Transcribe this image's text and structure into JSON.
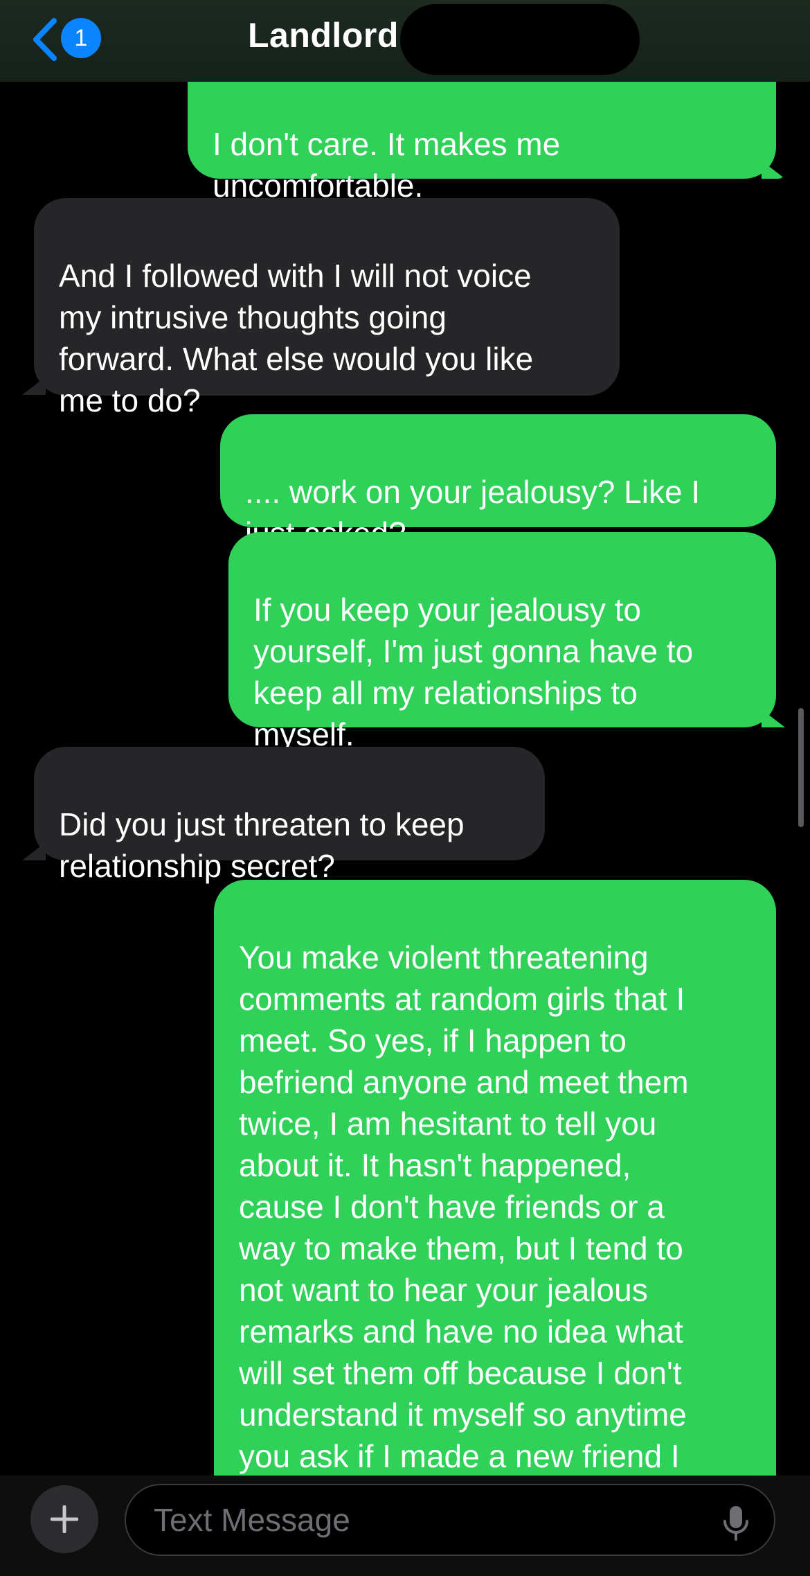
{
  "header": {
    "title": "Landlord",
    "back_badge": "1"
  },
  "messages": [
    {
      "from": "me",
      "text": "I don't care. It makes me\nuncomfortable."
    },
    {
      "from": "them",
      "text": "And I followed with I will not voice\nmy intrusive thoughts going\nforward. What else would you like\nme to do?"
    },
    {
      "from": "me",
      "text": ".... work on your jealousy? Like I\njust asked?"
    },
    {
      "from": "me",
      "text": "If you keep your jealousy to\nyourself, I'm just gonna have to\nkeep all my relationships to\nmyself."
    },
    {
      "from": "them",
      "text": "Did you just threaten to keep\nrelationship secret?"
    },
    {
      "from": "me",
      "text": "You make violent threatening\ncomments at random girls that I\nmeet. So yes, if I happen to\nbefriend anyone and meet them\ntwice, I am hesitant to tell you\nabout it. It hasn't happened,\ncause I don't have friends or a\nway to make them, but I tend to\nnot want to hear your jealous\nremarks and have no idea what\nwill set them off because I don't\nunderstand it myself so anytime\nyou ask if I made a new friend I\njust tell you no"
    }
  ],
  "composer": {
    "placeholder": "Text Message"
  },
  "icons": {
    "back": "chevron-left-icon",
    "add": "plus-icon",
    "mic": "microphone-icon"
  },
  "colors": {
    "outgoing_bubble": "#30d158",
    "incoming_bubble": "#262629",
    "badge": "#0a84ff",
    "accent": "#0a84ff"
  }
}
